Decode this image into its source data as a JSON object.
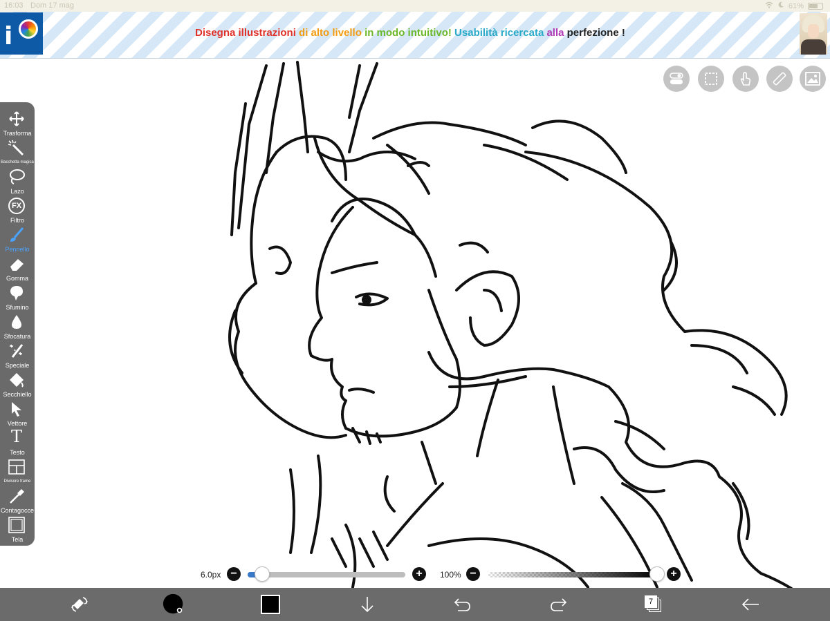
{
  "status_bar": {
    "time": "16:03",
    "date": "Dom 17 mag",
    "battery": "61%"
  },
  "banner": {
    "logo_icon": "ibispaint-logo",
    "segments": [
      {
        "text": "Disegna illustrazioni ",
        "color": "#e0312a"
      },
      {
        "text": "di alto ",
        "color": "#f29c11"
      },
      {
        "text": "livello ",
        "color": "#f29c11"
      },
      {
        "text": "in modo intuitivo! ",
        "color": "#6bb82a"
      },
      {
        "text": "Usabilità ricercata ",
        "color": "#2aa9c8"
      },
      {
        "text": "alla ",
        "color": "#b038b5"
      },
      {
        "text": "perfezione ",
        "color": "#222222"
      },
      {
        "text": "!",
        "color": "#222222"
      }
    ]
  },
  "top_buttons": [
    {
      "icon": "toggle-icon"
    },
    {
      "icon": "selection-icon"
    },
    {
      "icon": "hand-touch-icon"
    },
    {
      "icon": "ruler-icon"
    },
    {
      "icon": "reference-image-icon"
    }
  ],
  "toolbar": {
    "tools": [
      {
        "label": "Trasforma",
        "icon": "move-icon"
      },
      {
        "label": "Bacchetta magica",
        "icon": "magic-wand-icon"
      },
      {
        "label": "Lazo",
        "icon": "lasso-icon"
      },
      {
        "label": "Filtro",
        "icon": "fx-icon",
        "glyph": "FX"
      },
      {
        "label": "Pennello",
        "icon": "brush-icon",
        "active": true
      },
      {
        "label": "Gomma",
        "icon": "eraser-icon"
      },
      {
        "label": "Sfumino",
        "icon": "smudge-icon"
      },
      {
        "label": "Sfocatura",
        "icon": "blur-drop-icon"
      },
      {
        "label": "Speciale",
        "icon": "special-wand-icon"
      },
      {
        "label": "Secchiello",
        "icon": "bucket-icon"
      },
      {
        "label": "Vettore",
        "icon": "vector-arrow-icon"
      },
      {
        "label": "Testo",
        "icon": "text-icon",
        "glyph": "T"
      },
      {
        "label": "Divisore frame",
        "icon": "frame-divider-icon"
      },
      {
        "label": "Contagocce",
        "icon": "eyedropper-icon"
      },
      {
        "label": "Tela",
        "icon": "canvas-icon"
      }
    ],
    "active_color": "#4aa3ff"
  },
  "brush_size": {
    "label": "6.0px",
    "value_fraction": 0.09,
    "minus": "−",
    "plus": "+"
  },
  "opacity": {
    "label": "100%",
    "value_fraction": 1.0,
    "minus": "−",
    "plus": "+"
  },
  "bottom_bar": {
    "layer_count": "7",
    "buttons": [
      {
        "icon": "swap-color-eraser-icon"
      },
      {
        "icon": "brush-size-preview-icon"
      },
      {
        "icon": "color-swatch-icon",
        "color": "#000000"
      },
      {
        "icon": "download-arrow-icon"
      },
      {
        "icon": "undo-icon"
      },
      {
        "icon": "redo-icon"
      },
      {
        "icon": "layers-icon"
      },
      {
        "icon": "back-arrow-icon"
      }
    ]
  }
}
